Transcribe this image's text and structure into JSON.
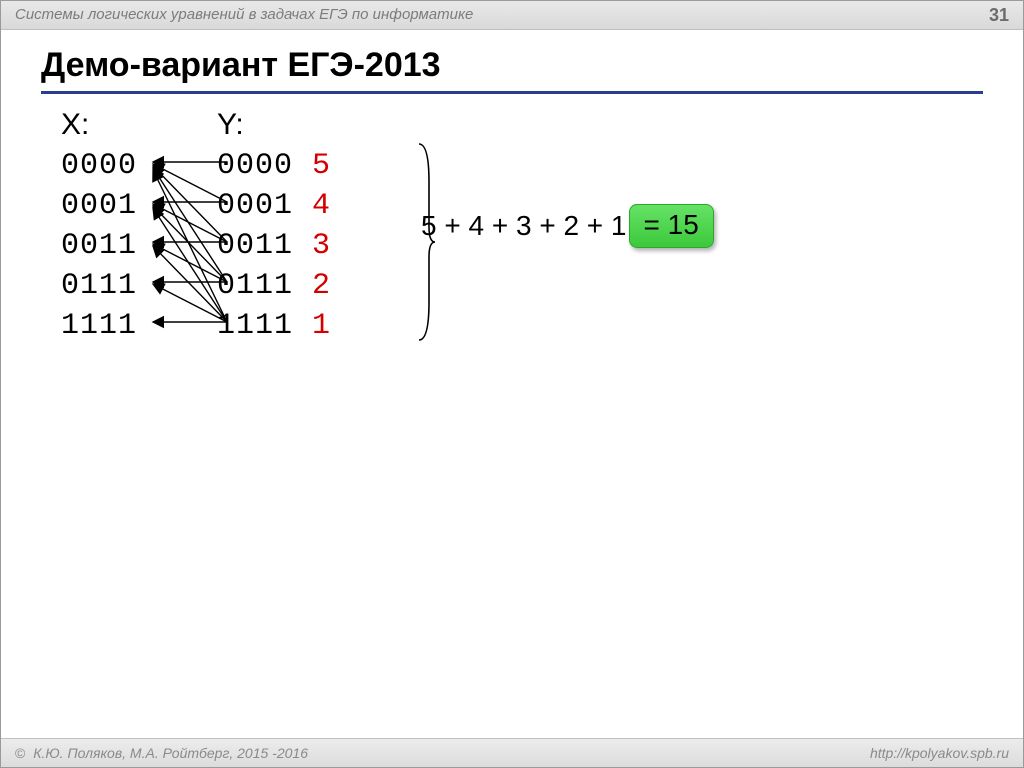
{
  "header": {
    "subject": "Системы логических уравнений в задачах ЕГЭ по информатике",
    "page_number": "31"
  },
  "title": "Демо-вариант ЕГЭ-2013",
  "columns": {
    "x": {
      "label": "X:",
      "rows": [
        "0000",
        "0001",
        "0011",
        "0111",
        "1111"
      ]
    },
    "y": {
      "label": "Y:",
      "rows": [
        {
          "bits": "0000",
          "count": "5"
        },
        {
          "bits": "0001",
          "count": "4"
        },
        {
          "bits": "0011",
          "count": "3"
        },
        {
          "bits": "0111",
          "count": "2"
        },
        {
          "bits": "1111",
          "count": "1"
        }
      ]
    }
  },
  "equation": {
    "lhs": "5 + 4 + 3 + 2 + 1 ",
    "rhs": "= 15"
  },
  "footer": {
    "copyright_symbol": "©",
    "authors": "К.Ю. Поляков, М.А. Ройтберг, 2015 -2016",
    "url": "http://kpolyakov.spb.ru"
  }
}
